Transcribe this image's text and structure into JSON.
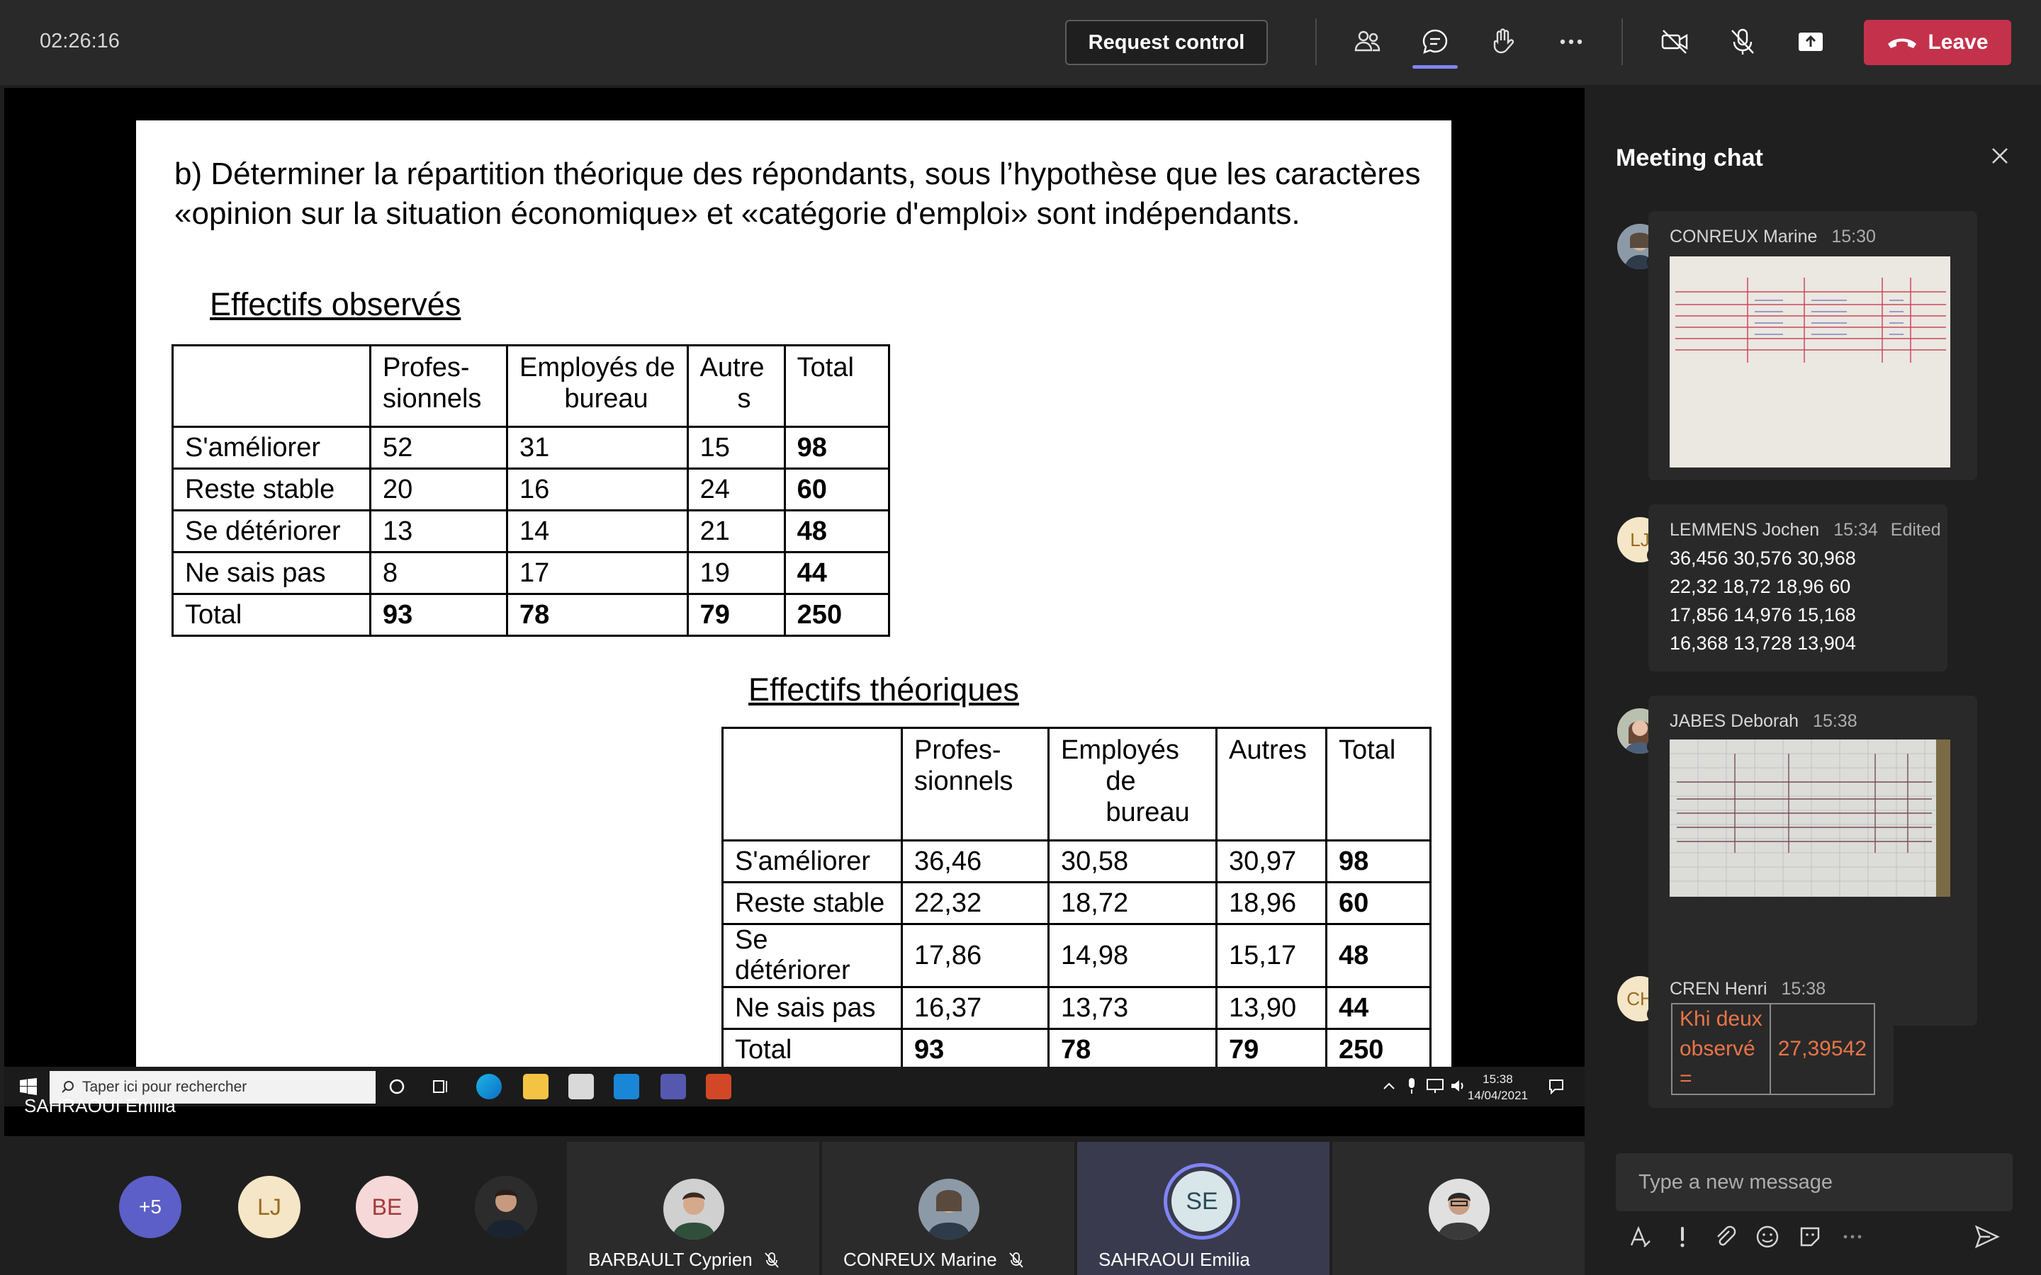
{
  "meeting": {
    "timer": "02:26:16",
    "request_control_label": "Request control",
    "leave_label": "Leave"
  },
  "slide": {
    "question": "b) Déterminer la répartition théorique des répondants, sous l’hypothèse que les caractères «opinion sur la situation économique» et «catégorie d'emploi» sont indépendants.",
    "observed": {
      "title": "Effectifs observés",
      "headers": [
        "",
        "Profes-\nsionnels",
        "Employés de\n      bureau",
        "Autre\n     s",
        "Total"
      ],
      "rows": [
        [
          "S'améliorer",
          "52",
          "31",
          "15",
          "98"
        ],
        [
          "Reste stable",
          "20",
          "16",
          "24",
          "60"
        ],
        [
          "Se détériorer",
          "13",
          "14",
          "21",
          "48"
        ],
        [
          "Ne sais pas",
          "8",
          "17",
          "19",
          "44"
        ],
        [
          "Total",
          "93",
          "78",
          "79",
          "250"
        ]
      ]
    },
    "theoretical": {
      "title": "Effectifs théoriques",
      "headers": [
        "",
        "Profes-\nsionnels",
        "Employés\n      de\n      bureau",
        "Autres",
        "Total"
      ],
      "rows": [
        [
          "S'améliorer",
          "36,46",
          "30,58",
          "30,97",
          "98"
        ],
        [
          "Reste stable",
          "22,32",
          "18,72",
          "18,96",
          "60"
        ],
        [
          "Se détériorer",
          "17,86",
          "14,98",
          "15,17",
          "48"
        ],
        [
          "Ne sais pas",
          "16,37",
          "13,73",
          "13,90",
          "44"
        ],
        [
          "Total",
          "93",
          "78",
          "79",
          "250"
        ]
      ]
    }
  },
  "taskbar": {
    "search_placeholder": "Taper ici pour rechercher",
    "time": "15:38",
    "date": "14/04/2021"
  },
  "presenter_name": "SAHRAOUI Emilia",
  "chat": {
    "title": "Meeting chat",
    "compose_placeholder": "Type a new message",
    "messages": [
      {
        "author": "CONREUX Marine",
        "time": "15:30"
      },
      {
        "author": "LEMMENS Jochen",
        "initials": "LJ",
        "time": "15:34",
        "edited": "Edited",
        "lines": [
          "36,456 30,576 30,968",
          "22,32 18,72 18,96 60",
          "17,856 14,976 15,168",
          "16,368 13,728 13,904"
        ]
      },
      {
        "author": "JABES Deborah",
        "time": "15:38"
      },
      {
        "author": "CREN Henri",
        "initials": "CH",
        "time": "15:38",
        "khi_label_lines": [
          "Khi deux",
          "observé",
          "="
        ],
        "khi_value": "27,39542"
      }
    ]
  },
  "participants": {
    "overflow": "+5",
    "initials": [
      "LJ",
      "BE"
    ],
    "tiles": [
      {
        "name": "BARBAULT Cyprien"
      },
      {
        "name": "CONREUX Marine"
      },
      {
        "name": "SAHRAOUI Emilia",
        "initials": "SE"
      }
    ]
  },
  "colors": {
    "leave": "#c4314b",
    "accent": "#7f85f5",
    "khi_text": "#e97548"
  }
}
